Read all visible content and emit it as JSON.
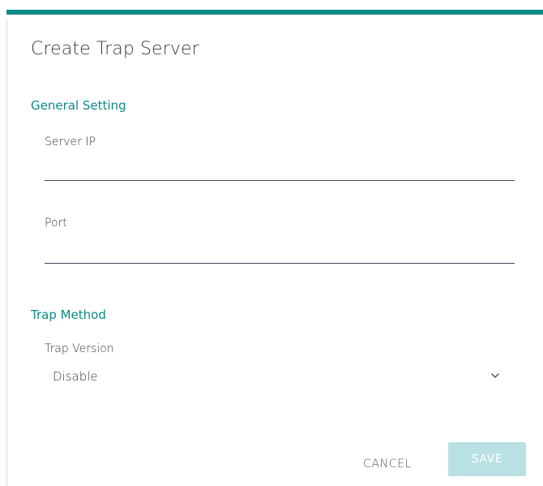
{
  "dialog": {
    "title": "Create Trap Server",
    "accent_color": "#0b8b86"
  },
  "general_setting": {
    "heading": "General Setting",
    "server_ip": {
      "label": "Server IP",
      "value": ""
    },
    "port": {
      "label": "Port",
      "value": ""
    }
  },
  "trap_method": {
    "heading": "Trap Method",
    "trap_version": {
      "label": "Trap Version",
      "selected": "Disable",
      "icon": "chevron-down-icon"
    }
  },
  "actions": {
    "cancel_label": "CANCEL",
    "save_label": "SAVE",
    "save_disabled_color": "#b9e1e3"
  }
}
